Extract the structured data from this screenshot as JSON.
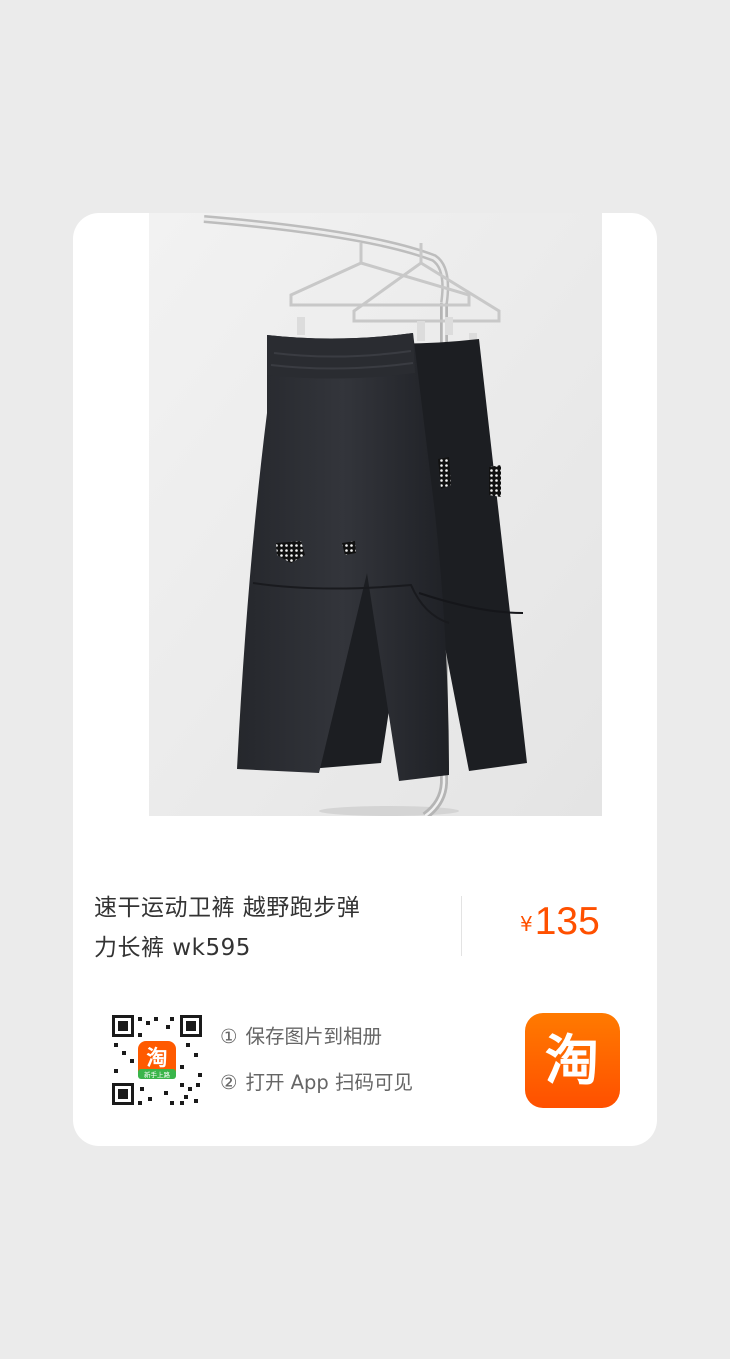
{
  "product": {
    "title_line1": "速干运动卫裤 越野跑步弹",
    "title_line2": "力长裤 wk595",
    "currency": "¥",
    "price": "135"
  },
  "share": {
    "steps": [
      {
        "num": "①",
        "text": "保存图片到相册"
      },
      {
        "num": "②",
        "text": "打开 App 扫码可见"
      }
    ]
  },
  "qr": {
    "center_glyph": "淘",
    "center_tag": "新手上路"
  },
  "logo": {
    "glyph": "淘"
  },
  "colors": {
    "brand_orange": "#ff5000",
    "background": "#ebebeb",
    "card": "#ffffff"
  }
}
